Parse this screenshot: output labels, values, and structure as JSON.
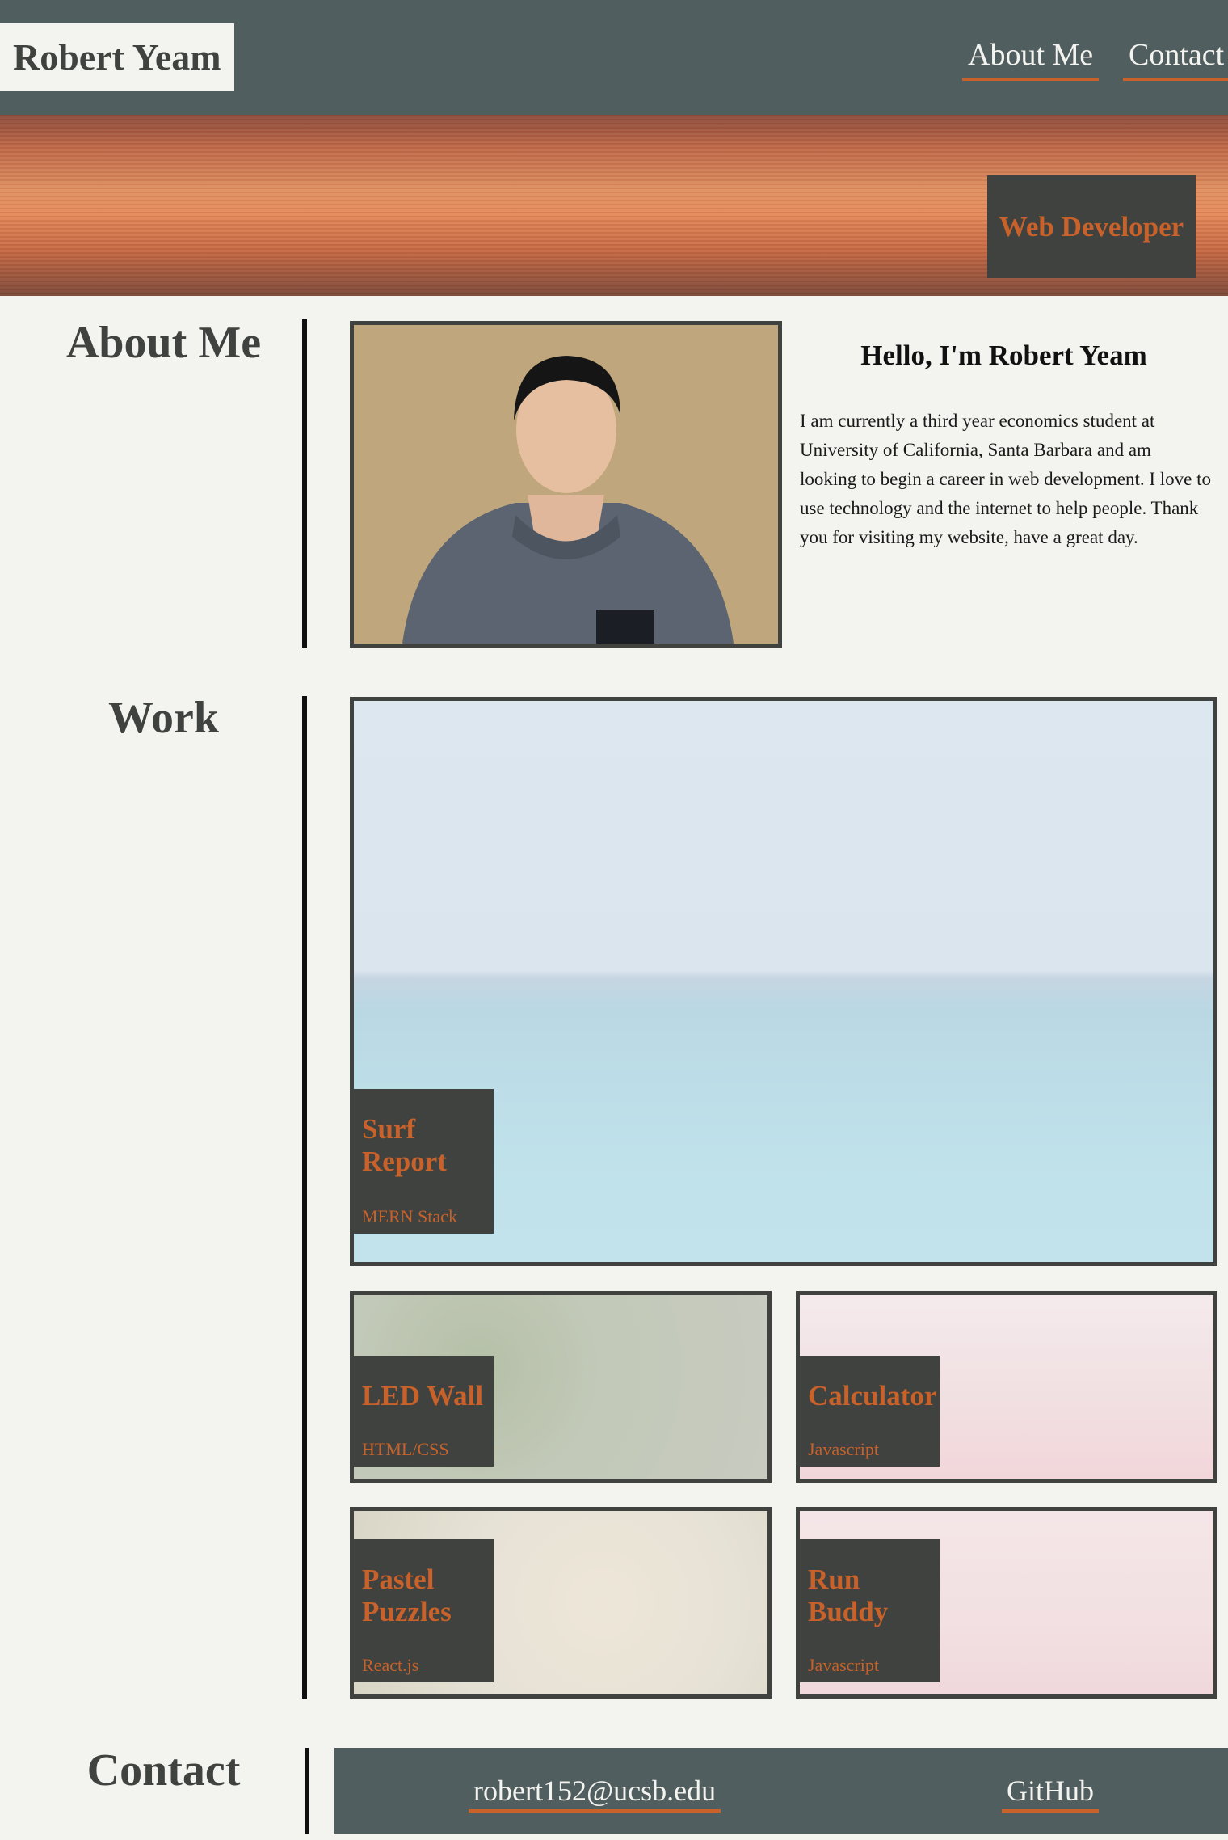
{
  "header": {
    "brand": "Robert Yeam",
    "nav": [
      {
        "label": "About Me"
      },
      {
        "label": "Contact"
      }
    ]
  },
  "hero": {
    "badge": "Web Developer"
  },
  "about": {
    "title": "About Me",
    "greeting": "Hello, I'm Robert Yeam",
    "bio": "I am currently a third year economics student at University of California, Santa Barbara and am looking to begin a career in web development. I love to use technology and the internet to help people. Thank you for visiting my website, have a great day."
  },
  "work": {
    "title": "Work",
    "projects": [
      {
        "name": "Surf Report",
        "tech": "MERN Stack"
      },
      {
        "name": "LED Wall",
        "tech": "HTML/CSS"
      },
      {
        "name": "Calculator",
        "tech": "Javascript"
      },
      {
        "name": "Pastel Puzzles",
        "tech": "React.js"
      },
      {
        "name": "Run Buddy",
        "tech": "Javascript"
      }
    ]
  },
  "contact": {
    "title": "Contact",
    "email": "robert152@ucsb.edu",
    "github": "GitHub"
  },
  "colors": {
    "header_bg": "#515e5f",
    "dark": "#3f423f",
    "accent": "#c8612a",
    "page_bg": "#f3f3ef"
  }
}
